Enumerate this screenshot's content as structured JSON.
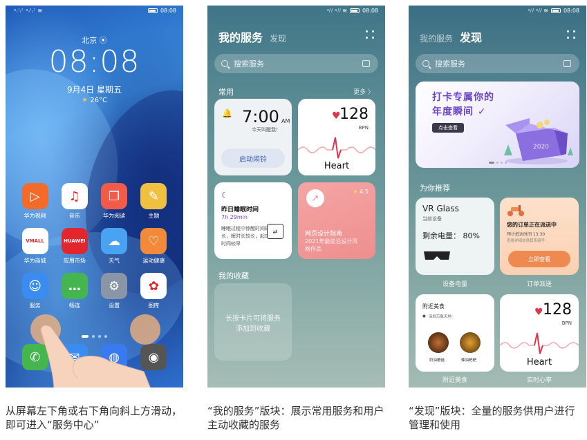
{
  "phone1": {
    "status": {
      "signal": "ᵃᵢˡᵢˡ ᵃᵢˡᵢˡ ≋",
      "time": "08:08"
    },
    "city": "北京",
    "clock": "08:08",
    "date": "9月4日 星期五",
    "weather": "26°C",
    "apps": [
      {
        "label": "华为视频",
        "icon": "video-icon",
        "color": "#f26b2a",
        "glyph": "▷"
      },
      {
        "label": "音乐",
        "icon": "music-icon",
        "color": "#ffffff",
        "glyph": "♫"
      },
      {
        "label": "华为阅读",
        "icon": "book-icon",
        "color": "#f25b4a",
        "glyph": "❐"
      },
      {
        "label": "主题",
        "icon": "brush-icon",
        "color": "#f0c040",
        "glyph": "✎"
      },
      {
        "label": "华为商城",
        "icon": "vmall-icon",
        "color": "#ffffff",
        "glyph": "VMALL"
      },
      {
        "label": "应用市场",
        "icon": "appgallery-icon",
        "color": "#e3262e",
        "glyph": "HUAWEI"
      },
      {
        "label": "天气",
        "icon": "weather-icon",
        "color": "#4aa3f0",
        "glyph": "☁"
      },
      {
        "label": "运动健康",
        "icon": "health-icon",
        "color": "#f28a3a",
        "glyph": "♡"
      },
      {
        "label": "服务",
        "icon": "service-icon",
        "color": "#3a8cf0",
        "glyph": "☺"
      },
      {
        "label": "畅连",
        "icon": "chat-icon",
        "color": "#45b550",
        "glyph": "…"
      },
      {
        "label": "设置",
        "icon": "settings-icon",
        "color": "#8a95a8",
        "glyph": "⚙"
      },
      {
        "label": "图库",
        "icon": "gallery-icon",
        "color": "#ffffff",
        "glyph": "✿"
      }
    ],
    "dock": [
      {
        "icon": "phone-icon",
        "color": "#45b550",
        "glyph": "✆"
      },
      {
        "icon": "messages-icon",
        "color": "#3a8cf0",
        "glyph": "✉"
      },
      {
        "icon": "browser-icon",
        "color": "#3a7af0",
        "glyph": "◍"
      },
      {
        "icon": "camera-icon",
        "color": "#555555",
        "glyph": "◉"
      }
    ]
  },
  "phone2": {
    "status": {
      "signal": "ᵃᵢˡᵢˡ ᵃᵢˡᵢˡ ≋",
      "time": "08:08"
    },
    "tab_active": "我的服务",
    "tab_other": "发现",
    "search_placeholder": "搜索服务",
    "section_common": "常用",
    "section_more": "更多 〉",
    "alarm": {
      "time": "7:00",
      "ampm": "AM",
      "subtitle": "今天叫醒我！",
      "button": "启动闹铃"
    },
    "heart": {
      "value": "128",
      "unit": "BPN",
      "label": "Heart"
    },
    "sleep": {
      "title": "昨日睡眠时间",
      "duration": "7h 29min",
      "desc": "睡眠过程中惊醒时间较长，眠时长较长，起床时间较早"
    },
    "design": {
      "rating": "4.5",
      "title": "网页设计指南",
      "subtitle": "2021年最前沿设计风格作品"
    },
    "section_favorites": "我的收藏",
    "favorites_hint": "长按卡片可将服务添加到收藏"
  },
  "phone3": {
    "status": {
      "signal": "ᵃᵢˡᵢˡ ᵃᵢˡᵢˡ ≋",
      "time": "08:08"
    },
    "tab_other": "我的服务",
    "tab_active": "发现",
    "search_placeholder": "搜索服务",
    "promo": {
      "line1": "打卡专属你的",
      "line2": "年度瞬间 ✓",
      "button": "点击查看",
      "year": "2020"
    },
    "section_recommend": "为你推荐",
    "vr": {
      "title": "VR Glass",
      "subtitle": "当前设备",
      "battery": "剩余电量：  80%"
    },
    "vr_caption": "设备电量",
    "order": {
      "title": "您的订单正在派送中",
      "eta": "预计抵达时间 13:30",
      "note": "查看详细信息联系骑手",
      "button": "立即查看"
    },
    "order_caption": "订单派送",
    "food": {
      "title": "附近美食",
      "location": "深圳万象天地",
      "dish1": "奶油蘑菇",
      "dish2": "辣油粑粑"
    },
    "food_caption": "附近美食",
    "heart": {
      "value": "128",
      "unit": "BPN",
      "label": "Heart"
    },
    "heart_caption": "实时心率"
  },
  "captions": {
    "c1": "从屏幕左下角或右下角向斜上方滑动，即可进入“服务中心”",
    "c2": "“我的服务”版块：展示常用服务和用户主动收藏的服务",
    "c3": "“发现”版块：全量的服务供用户进行管理和使用"
  }
}
